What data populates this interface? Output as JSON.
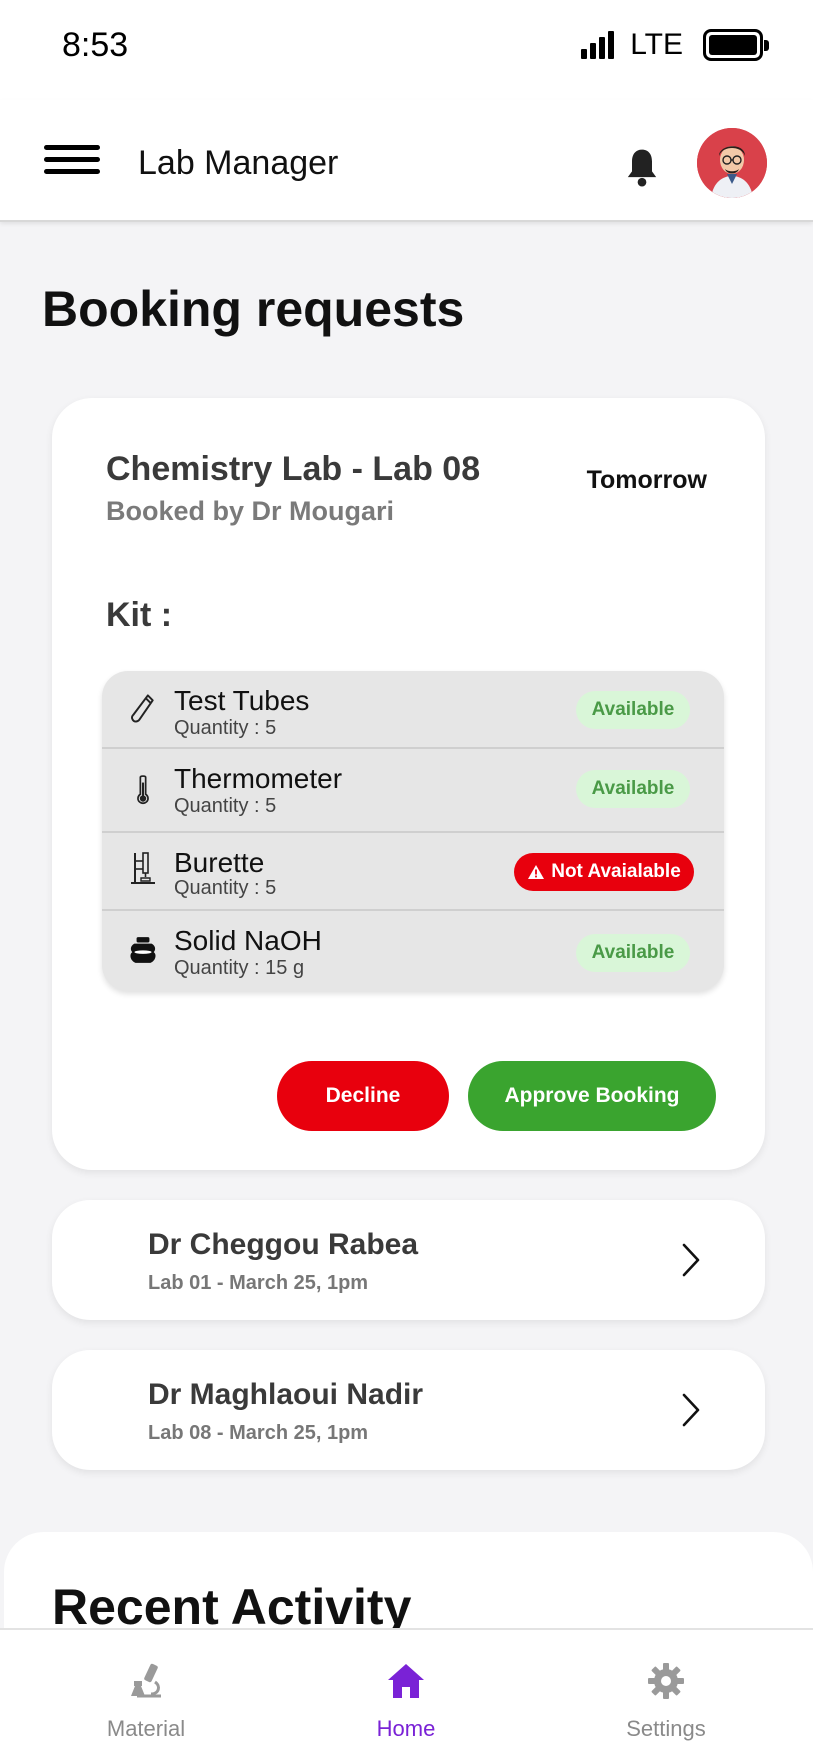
{
  "status_bar": {
    "time": "8:53",
    "network": "LTE"
  },
  "header": {
    "title": "Lab Manager"
  },
  "page": {
    "heading": "Booking requests"
  },
  "booking_card": {
    "title": "Chemistry Lab - Lab 08",
    "subtitle": "Booked by Dr Mougari",
    "when": "Tomorrow",
    "kit_label": "Kit :",
    "items": [
      {
        "name": "Test Tubes",
        "quantity": "Quantity : 5",
        "status": "Available",
        "icon": "test-tube-icon"
      },
      {
        "name": "Thermometer",
        "quantity": "Quantity : 5",
        "status": "Available",
        "icon": "thermometer-icon"
      },
      {
        "name": "Burette",
        "quantity": "Quantity : 5",
        "status": "Not Avaialable",
        "icon": "burette-icon"
      },
      {
        "name": "Solid NaOH",
        "quantity": "Quantity : 15 g",
        "status": "Available",
        "icon": "chemical-jar-icon"
      }
    ],
    "decline_label": "Decline",
    "approve_label": "Approve Booking"
  },
  "requests": [
    {
      "name": "Dr Cheggou Rabea",
      "detail": "Lab 01 - March 25, 1pm"
    },
    {
      "name": "Dr Maghlaoui Nadir",
      "detail": "Lab 08 - March 25, 1pm"
    }
  ],
  "recent": {
    "title": "Recent Activity"
  },
  "tabs": [
    {
      "label": "Material",
      "icon": "microscope-icon"
    },
    {
      "label": "Home",
      "icon": "home-icon"
    },
    {
      "label": "Settings",
      "icon": "gear-icon"
    }
  ],
  "colors": {
    "accent": "#7a22d6",
    "approve": "#3aa42f",
    "decline": "#e8000d",
    "available_bg": "#d9f6d8",
    "available_text": "#4a9a47"
  }
}
